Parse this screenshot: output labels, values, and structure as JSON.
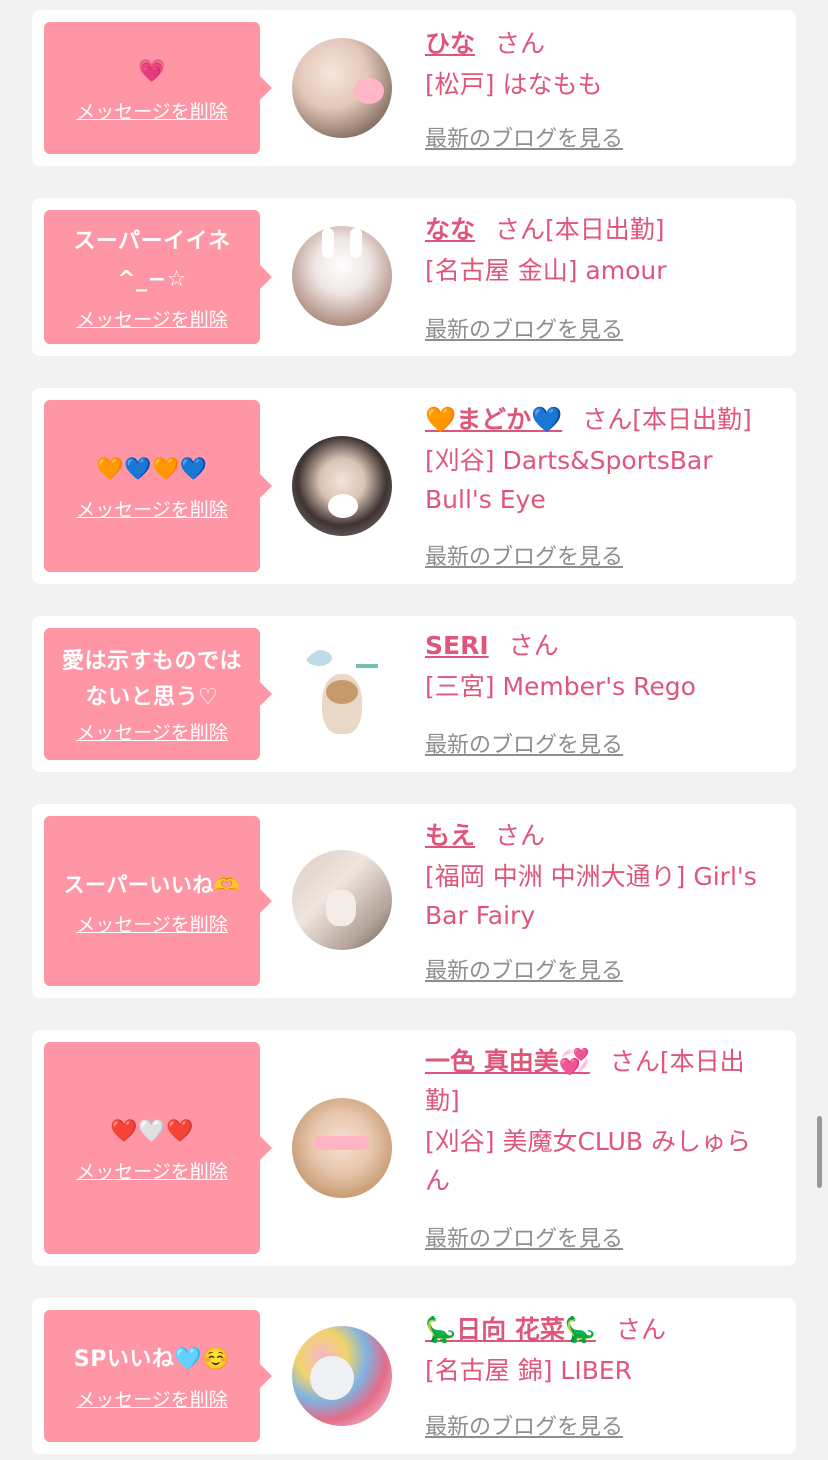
{
  "common": {
    "delete_label": "メッセージを削除",
    "blog_label": "最新のブログを見る",
    "san_suffix": "さん"
  },
  "colors": {
    "bubble": "#ff96a6",
    "name": "#e0567a",
    "link_gray": "#8e8e8e",
    "background": "#f2f2f2"
  },
  "cards": [
    {
      "message": "💗",
      "name": "ひな",
      "status": "",
      "shop": "[松戸] はなもも",
      "avatar": "avatar-photo-hina"
    },
    {
      "message": "スーパーイイネ\n^_−☆",
      "name": "なな",
      "status": "[本日出勤]",
      "shop": "[名古屋 金山] amour",
      "avatar": "avatar-photo-nana"
    },
    {
      "message": "🧡💙🧡💙",
      "name": "🧡まどか💙",
      "status": "[本日出勤]",
      "shop": "[刈谷] Darts&SportsBar Bull's Eye",
      "avatar": "avatar-photo-madoka"
    },
    {
      "message": "愛は示すものでは\nないと思う♡",
      "name": "SERI",
      "status": "",
      "shop": "[三宮] Member's Rego",
      "avatar": "avatar-illustration-cat"
    },
    {
      "message": "スーパーいいね🫶",
      "name": "もえ",
      "status": "",
      "shop": "[福岡 中洲 中洲大通り] Girl's Bar Fairy",
      "avatar": "avatar-photo-moe"
    },
    {
      "message": "❤️🤍❤️",
      "name": "一色 真由美💞",
      "status": "[本日出勤]",
      "shop": "[刈谷] 美魔女CLUB みしゅらん",
      "avatar": "avatar-photo-mayumi"
    },
    {
      "message": "SPいいね🩵☺️",
      "name": "🦕日向 花菜🦕",
      "status": "",
      "shop": "[名古屋 錦] LIBER",
      "avatar": "avatar-photo-kana"
    }
  ]
}
